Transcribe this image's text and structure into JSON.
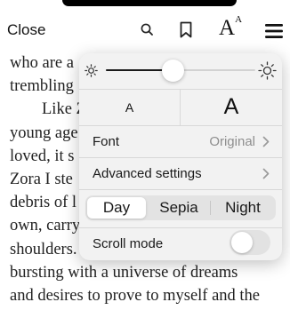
{
  "toolbar": {
    "close_label": "Close",
    "icons": [
      "search-icon",
      "bookmark-icon",
      "text-size-icon",
      "menu-icon"
    ],
    "text_size_glyph_big": "A",
    "text_size_glyph_small": "A"
  },
  "reading_lines": [
    "who are a",
    "trembling",
    "Like Z",
    "young age",
    "loved, it s",
    "Zora I ste",
    "debris of l",
    "own, carry",
    "shoulders. Like Zora I lived full to",
    "bursting with a universe of dreams",
    "and desires to prove to myself and the"
  ],
  "panel": {
    "brightness": {
      "level": 0.45,
      "low_icon": "sun-low-icon",
      "high_icon": "sun-high-icon"
    },
    "font_size": {
      "smaller_label": "A",
      "larger_label": "A"
    },
    "font": {
      "label": "Font",
      "value": "Original"
    },
    "advanced": {
      "label": "Advanced settings"
    },
    "themes": {
      "options": [
        "Day",
        "Sepia",
        "Night"
      ],
      "selected": "Day"
    },
    "scroll_mode": {
      "label": "Scroll mode",
      "enabled": false
    }
  },
  "colors": {
    "panel_bg": "#f2f2f2",
    "text": "#1a1a1a",
    "secondary_text": "#8e8e8e",
    "slider_fill": "#1a1a1a"
  }
}
